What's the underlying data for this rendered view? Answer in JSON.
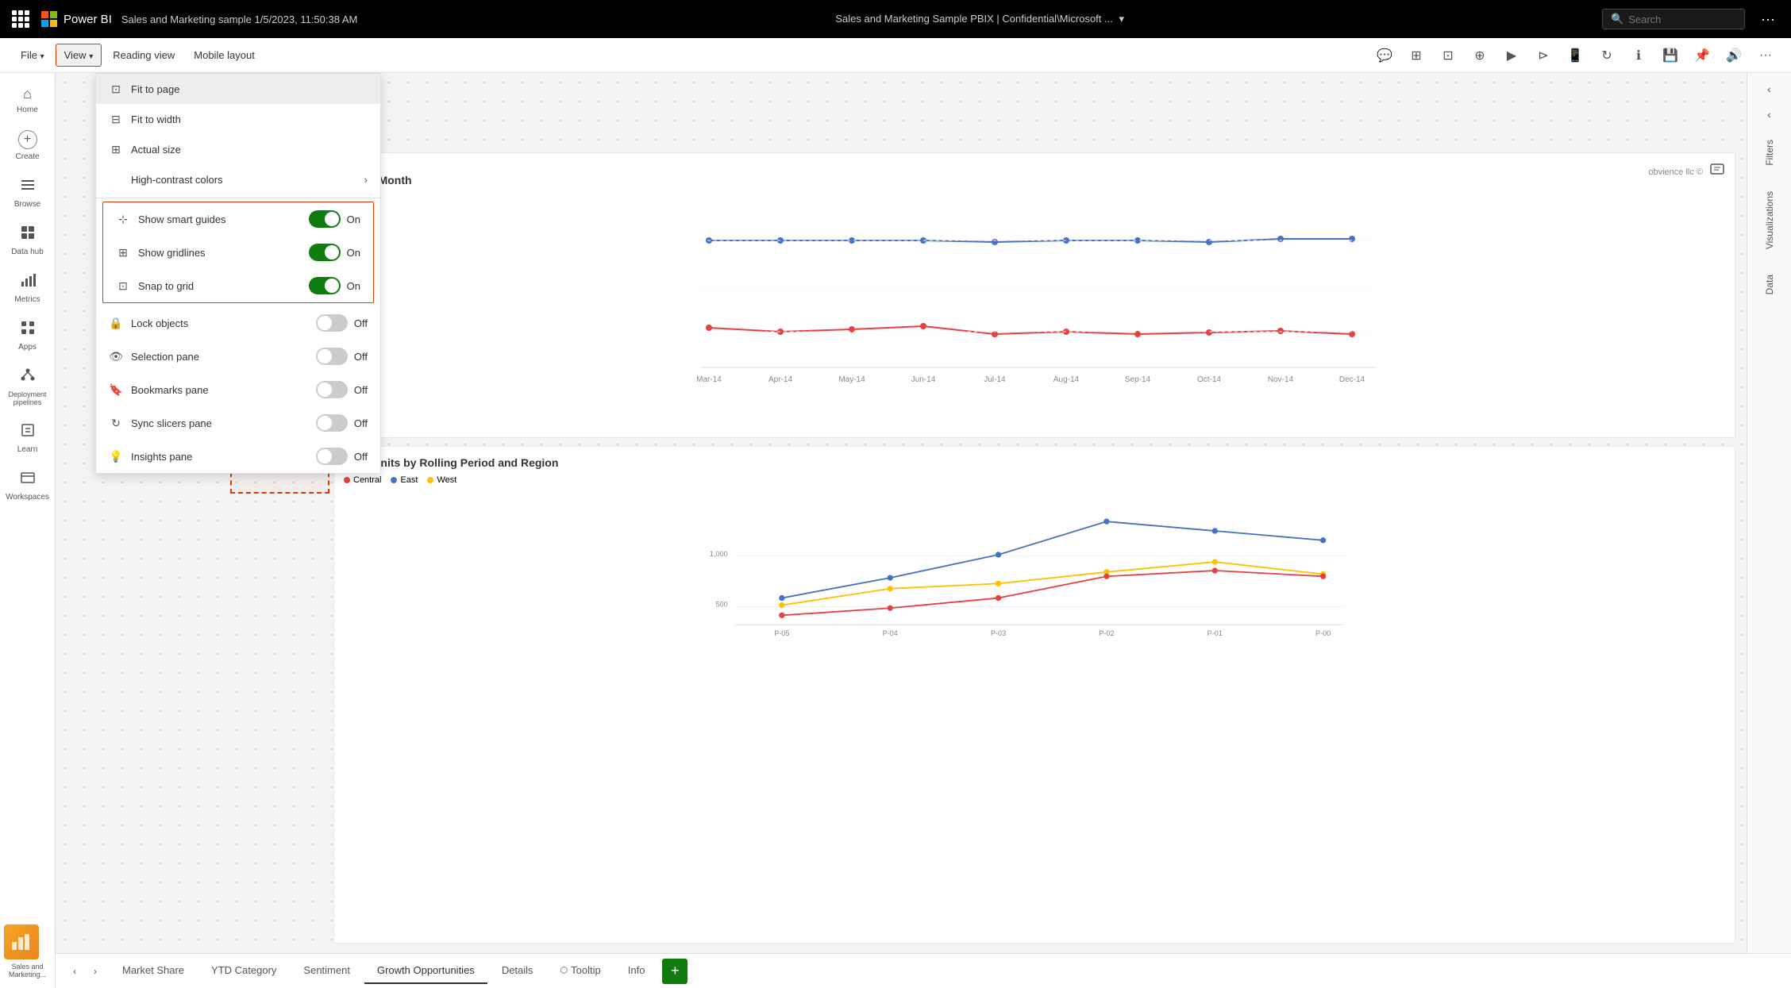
{
  "topbar": {
    "app_name": "Power BI",
    "file_name": "Sales and Marketing sample 1/5/2023, 11:50:38 AM",
    "dataset_name": "Sales and Marketing Sample PBIX | Confidential\\Microsoft ...",
    "search_placeholder": "Search",
    "more_icon": "···"
  },
  "menubar": {
    "file_label": "File",
    "view_label": "View",
    "reading_view_label": "Reading view",
    "mobile_layout_label": "Mobile layout"
  },
  "dropdown": {
    "fit_to_page": "Fit to page",
    "fit_to_width": "Fit to width",
    "actual_size": "Actual size",
    "high_contrast": "High-contrast colors",
    "show_smart_guides": "Show smart guides",
    "show_gridlines": "Show gridlines",
    "snap_to_grid": "Snap to grid",
    "lock_objects": "Lock objects",
    "selection_pane": "Selection pane",
    "bookmarks_pane": "Bookmarks pane",
    "sync_slicers_pane": "Sync slicers pane",
    "insights_pane": "Insights pane",
    "smart_guides_on": "On",
    "gridlines_on": "On",
    "snap_on": "On",
    "lock_off": "Off",
    "selection_off": "Off",
    "bookmarks_off": "Off",
    "sync_off": "Off",
    "insights_off": "Off"
  },
  "chart_top": {
    "title": "Ms by Month",
    "logo": "obvience llc ©",
    "x_labels": [
      "Mar-14",
      "Apr-14",
      "May-14",
      "Jun-14",
      "Jul-14",
      "Aug-14",
      "Sep-14",
      "Oct-14",
      "Nov-14",
      "Dec-14"
    ]
  },
  "chart_bottom": {
    "title": "Total Units by Rolling Period and Region",
    "legend": [
      {
        "label": "Central",
        "color": "#e84040"
      },
      {
        "label": "East",
        "color": "#4472c4"
      },
      {
        "label": "West",
        "color": "#ffc000"
      }
    ],
    "x_labels": [
      "P-05",
      "P-04",
      "P-03",
      "P-02",
      "P-01",
      "P-00"
    ],
    "y_labels": [
      "500",
      "1,000"
    ]
  },
  "sidebar": {
    "items": [
      {
        "label": "Home",
        "icon": "⌂"
      },
      {
        "label": "Create",
        "icon": "+"
      },
      {
        "label": "Browse",
        "icon": "☰"
      },
      {
        "label": "Data hub",
        "icon": "⊞"
      },
      {
        "label": "Metrics",
        "icon": "📊"
      },
      {
        "label": "Apps",
        "icon": "⊡"
      },
      {
        "label": "Deployment pipelines",
        "icon": "⊳"
      },
      {
        "label": "Learn",
        "icon": "📖"
      },
      {
        "label": "Workspaces",
        "icon": "⊟"
      }
    ],
    "thumbnail_label": "Sales and Marketing..."
  },
  "right_panel": {
    "filters_label": "Filters",
    "visualizations_label": "Visualizations",
    "data_label": "Data"
  },
  "bottom_tabs": {
    "tabs": [
      {
        "label": "Market Share",
        "active": false
      },
      {
        "label": "YTD Category",
        "active": false
      },
      {
        "label": "Sentiment",
        "active": false
      },
      {
        "label": "Growth Opportunities",
        "active": true
      },
      {
        "label": "Details",
        "active": false
      },
      {
        "label": "Tooltip",
        "active": false
      },
      {
        "label": "Info",
        "active": false
      }
    ],
    "add_label": "+"
  }
}
